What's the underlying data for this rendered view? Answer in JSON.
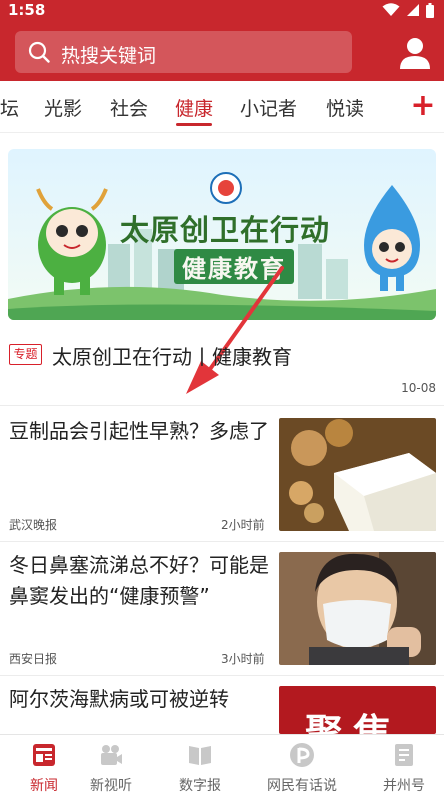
{
  "status": {
    "time": "1:58"
  },
  "search": {
    "placeholder": "热搜关键词"
  },
  "tabs": [
    {
      "label": "坛"
    },
    {
      "label": "光影"
    },
    {
      "label": "社会"
    },
    {
      "label": "健康"
    },
    {
      "label": "小记者"
    },
    {
      "label": "悦读"
    }
  ],
  "tabs_plus": "+",
  "banner": {
    "line1": "太原创卫在行动",
    "line2": "健康教育"
  },
  "topic": {
    "tag": "专题",
    "title": "太原创卫在行动丨健康教育",
    "date": "10-08"
  },
  "news": [
    {
      "title": "豆制品会引起性早熟？多虑了",
      "source": "武汉晚报",
      "time": "2小时前"
    },
    {
      "title": "冬日鼻塞流涕总不好？可能是鼻窦发出的“健康预警”",
      "source": "西安日报",
      "time": "3小时前"
    },
    {
      "title": "阿尔茨海默病或可被逆转",
      "thumb_text": "聚焦"
    }
  ],
  "nav": [
    {
      "label": "新闻",
      "icon": "news-icon"
    },
    {
      "label": "新视听",
      "icon": "video-icon"
    },
    {
      "label": "数字报",
      "icon": "book-icon"
    },
    {
      "label": "网民有话说",
      "icon": "speech-icon"
    },
    {
      "label": "并州号",
      "icon": "doc-icon"
    }
  ],
  "colors": {
    "brand": "#c8272d",
    "accent": "#d8202a"
  }
}
